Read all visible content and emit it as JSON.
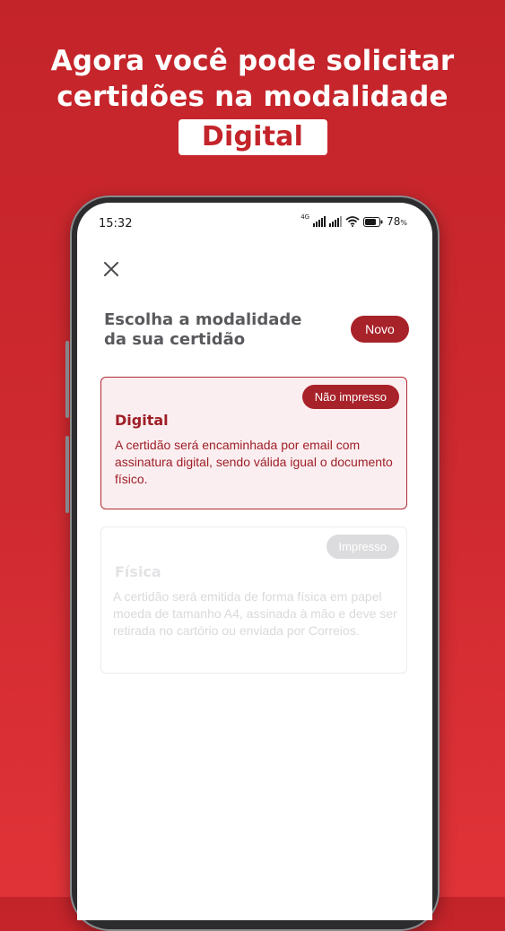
{
  "headline": {
    "line1": "Agora você pode solicitar",
    "line2": "certidões na modalidade",
    "highlight": "Digital"
  },
  "status_bar": {
    "time": "15:32",
    "network": "4G",
    "battery": "78",
    "battery_unit": "%"
  },
  "screen": {
    "title": "Escolha a modalidade da sua certidão",
    "new_badge": "Novo",
    "options": [
      {
        "badge": "Não impresso",
        "title": "Digital",
        "description": "A certidão será encaminhada por email com assinatura digital, sendo válida igual o documento físico.",
        "selected": true
      },
      {
        "badge": "Impresso",
        "title": "Física",
        "description": "A certidão será emitida de forma física em papel moeda de tamanho A4, assinada à mão e deve ser retirada no cartório ou enviada por Correios.",
        "selected": false
      }
    ]
  },
  "colors": {
    "brand_red": "#c3242a",
    "badge_red": "#a82229",
    "selected_bg": "#fbeef0"
  }
}
